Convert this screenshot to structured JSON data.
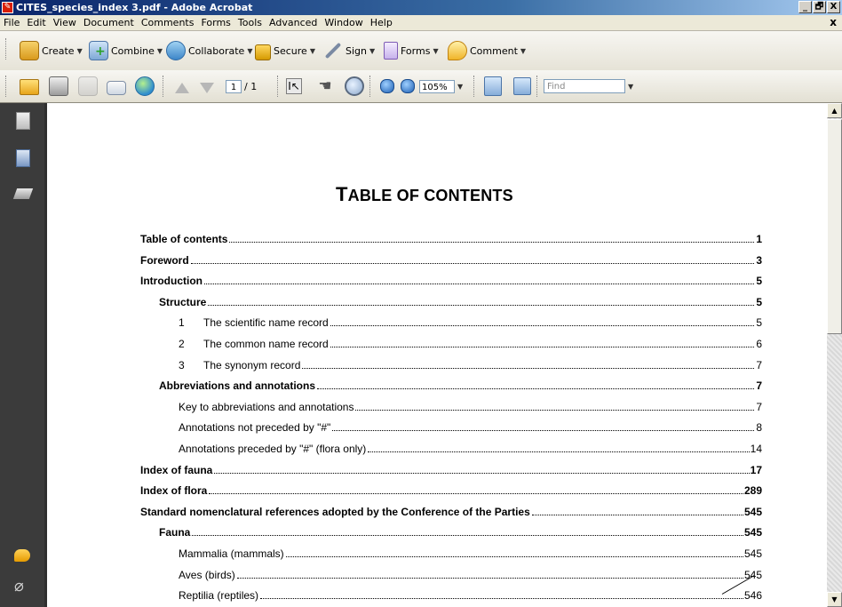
{
  "window": {
    "title": "CITES_species_index 3.pdf - Adobe Acrobat",
    "app_icon": "acrobat-icon",
    "controls": [
      "_",
      "🗗",
      "X"
    ]
  },
  "menubar": {
    "items": [
      "File",
      "Edit",
      "View",
      "Document",
      "Comments",
      "Forms",
      "Tools",
      "Advanced",
      "Window",
      "Help"
    ],
    "close": "x"
  },
  "toolbar1": {
    "create": "Create",
    "combine": "Combine",
    "collaborate": "Collaborate",
    "secure": "Secure",
    "sign": "Sign",
    "forms": "Forms",
    "comment": "Comment"
  },
  "toolbar2": {
    "page_current": "1",
    "page_total": "/ 1",
    "zoom": "105%",
    "find_placeholder": "Find"
  },
  "document": {
    "title_first": "T",
    "title_rest": "ABLE OF CONTENTS",
    "toc": [
      {
        "num": "",
        "text": "Table of contents",
        "page": "1",
        "bold": true,
        "indent": 0
      },
      {
        "num": "",
        "text": "Foreword",
        "page": "3",
        "bold": true,
        "indent": 0
      },
      {
        "num": "",
        "text": "Introduction",
        "page": "5",
        "bold": true,
        "indent": 0
      },
      {
        "num": "",
        "text": "Structure",
        "page": "5",
        "bold": true,
        "indent": 1
      },
      {
        "num": "1",
        "text": "The scientific name record",
        "page": "5",
        "bold": false,
        "indent": 2
      },
      {
        "num": "2",
        "text": "The common name record",
        "page": "6",
        "bold": false,
        "indent": 2
      },
      {
        "num": "3",
        "text": "The synonym record",
        "page": "7",
        "bold": false,
        "indent": 2
      },
      {
        "num": "",
        "text": "Abbreviations and annotations",
        "page": "7",
        "bold": true,
        "indent": 1
      },
      {
        "num": "",
        "text": "Key to abbreviations and annotations",
        "page": "7",
        "bold": false,
        "indent": 2
      },
      {
        "num": "",
        "text": "Annotations not preceded by \"#\"",
        "page": "8",
        "bold": false,
        "indent": 2
      },
      {
        "num": "",
        "text": "Annotations preceded by \"#\" (flora only)",
        "page": "14",
        "bold": false,
        "indent": 2
      },
      {
        "num": "",
        "text": "Index of fauna",
        "page": "17",
        "bold": true,
        "indent": 0
      },
      {
        "num": "",
        "text": "Index of flora",
        "page": "289",
        "bold": true,
        "indent": 0
      },
      {
        "num": "",
        "text": "Standard nomenclatural references adopted by the Conference of the Parties",
        "page": "545",
        "bold": true,
        "indent": 0
      },
      {
        "num": "",
        "text": "Fauna",
        "page": "545",
        "bold": true,
        "indent": 1
      },
      {
        "num": "",
        "text": "Mammalia (mammals)",
        "page": "545",
        "bold": false,
        "indent": 2
      },
      {
        "num": "",
        "text": "Aves (birds)",
        "page": "545",
        "bold": false,
        "indent": 2
      },
      {
        "num": "",
        "text": "Reptilia (reptiles)",
        "page": "546",
        "bold": false,
        "indent": 2
      }
    ]
  },
  "colors": {
    "titlebar_start": "#0a246a",
    "titlebar_end": "#a6caf0",
    "left_pane": "#3b3b3b"
  }
}
